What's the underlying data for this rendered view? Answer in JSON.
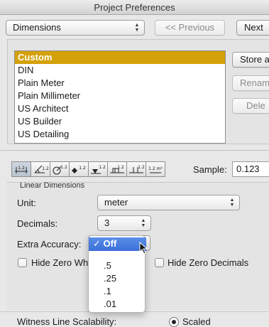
{
  "window": {
    "title": "Project Preferences"
  },
  "header": {
    "section_select": "Dimensions",
    "previous_label": "<< Previous",
    "next_label": "Next"
  },
  "presets": {
    "items": [
      "Custom",
      "DIN",
      "Plain Meter",
      "Plain Millimeter",
      "US Architect",
      "US Builder",
      "US Detailing"
    ],
    "selected": "Custom",
    "store_label": "Store a",
    "rename_label": "Renam",
    "delete_label": "Dele"
  },
  "toolbar": {
    "icons": [
      "linear-dimension-icon",
      "angular-dimension-icon",
      "radial-dimension-icon",
      "level-dimension-icon",
      "elevation-dimension-icon",
      "door-window-dimension-icon",
      "sill-height-dimension-icon",
      "area-dimension-icon"
    ],
    "icon_labels": [
      "1.2",
      "1.2",
      "1.2",
      "1.2",
      "1.2",
      "1.2",
      "1.2",
      "1.2 m²"
    ],
    "sample_label": "Sample:",
    "sample_value": "0.123"
  },
  "linear": {
    "section_title": "Linear Dimensions",
    "unit_label": "Unit:",
    "unit_value": "meter",
    "decimals_label": "Decimals:",
    "decimals_value": "3",
    "extra_accuracy_label": "Extra Accuracy:",
    "hide_zero_whole_label": "Hide Zero Wh",
    "hide_zero_decimals_label": "Hide Zero Decimals",
    "witness_label": "Witness Line Scalability:",
    "scaled_label": "Scaled"
  },
  "accuracy_menu": {
    "checkmark": "✓",
    "options": [
      "Off",
      ".5",
      ".25",
      ".1",
      ".01"
    ],
    "selected": "Off"
  },
  "colors": {
    "selection": "#d4a10a",
    "menu_highlight": "#3b6fd8"
  }
}
